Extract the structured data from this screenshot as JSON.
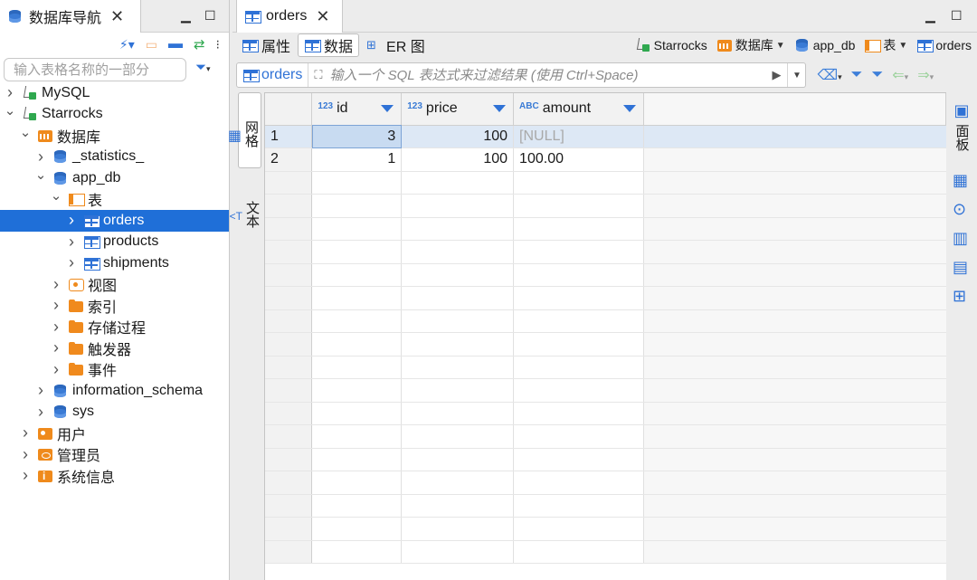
{
  "navigator": {
    "title": "数据库导航",
    "filter_placeholder": "输入表格名称的一部分",
    "tree": [
      {
        "label": "MySQL",
        "level": 0,
        "expanded": false,
        "icon": "connection-icon"
      },
      {
        "label": "Starrocks",
        "level": 0,
        "expanded": true,
        "icon": "connection-icon"
      },
      {
        "label": "数据库",
        "level": 1,
        "expanded": true,
        "icon": "databases-folder-icon"
      },
      {
        "label": "_statistics_",
        "level": 2,
        "expanded": false,
        "icon": "database-icon"
      },
      {
        "label": "app_db",
        "level": 2,
        "expanded": true,
        "icon": "database-icon"
      },
      {
        "label": "表",
        "level": 3,
        "expanded": true,
        "icon": "tables-folder-icon"
      },
      {
        "label": "orders",
        "level": 4,
        "expanded": false,
        "icon": "table-icon",
        "selected": true
      },
      {
        "label": "products",
        "level": 4,
        "expanded": false,
        "icon": "table-icon"
      },
      {
        "label": "shipments",
        "level": 4,
        "expanded": false,
        "icon": "table-icon"
      },
      {
        "label": "视图",
        "level": 3,
        "expanded": false,
        "icon": "views-folder-icon"
      },
      {
        "label": "索引",
        "level": 3,
        "expanded": false,
        "icon": "folder-icon"
      },
      {
        "label": "存储过程",
        "level": 3,
        "expanded": false,
        "icon": "folder-icon"
      },
      {
        "label": "触发器",
        "level": 3,
        "expanded": false,
        "icon": "folder-icon"
      },
      {
        "label": "事件",
        "level": 3,
        "expanded": false,
        "icon": "folder-icon"
      },
      {
        "label": "information_schema",
        "level": 2,
        "expanded": false,
        "icon": "database-icon"
      },
      {
        "label": "sys",
        "level": 2,
        "expanded": false,
        "icon": "database-icon"
      },
      {
        "label": "用户",
        "level": 1,
        "expanded": false,
        "icon": "users-folder-icon"
      },
      {
        "label": "管理员",
        "level": 1,
        "expanded": false,
        "icon": "admin-folder-icon"
      },
      {
        "label": "系统信息",
        "level": 1,
        "expanded": false,
        "icon": "info-folder-icon"
      }
    ]
  },
  "editor": {
    "tab_title": "orders",
    "subtabs": [
      {
        "label": "属性",
        "icon": "properties-icon"
      },
      {
        "label": "数据",
        "icon": "data-icon",
        "active": true
      },
      {
        "label": "ER 图",
        "icon": "er-diagram-icon"
      }
    ],
    "breadcrumb": [
      {
        "label": "Starrocks",
        "icon": "connection-icon",
        "dropdown": false
      },
      {
        "label": "数据库",
        "icon": "databases-folder-icon",
        "dropdown": true
      },
      {
        "label": "app_db",
        "icon": "database-icon",
        "dropdown": false
      },
      {
        "label": "表",
        "icon": "tables-folder-icon",
        "dropdown": true
      },
      {
        "label": "orders",
        "icon": "table-icon",
        "dropdown": false
      }
    ],
    "filter": {
      "table_label": "orders",
      "placeholder": "输入一个 SQL 表达式来过滤结果 (使用 Ctrl+Space)"
    },
    "view_tabs": {
      "grid": "网格",
      "text": "文本"
    },
    "panels_label": "面板",
    "grid": {
      "columns": [
        {
          "name": "id",
          "type_badge": "123",
          "align": "right"
        },
        {
          "name": "price",
          "type_badge": "123",
          "align": "right"
        },
        {
          "name": "amount",
          "type_badge": "ABC",
          "align": "left"
        }
      ],
      "rows": [
        {
          "num": "1",
          "cells": [
            "3",
            "100",
            "[NULL]"
          ]
        },
        {
          "num": "2",
          "cells": [
            "1",
            "100",
            "100.00"
          ]
        }
      ]
    }
  },
  "colors": {
    "selection": "#1f6fd8",
    "accent": "#2f72d6",
    "folder": "#f08a1d"
  }
}
